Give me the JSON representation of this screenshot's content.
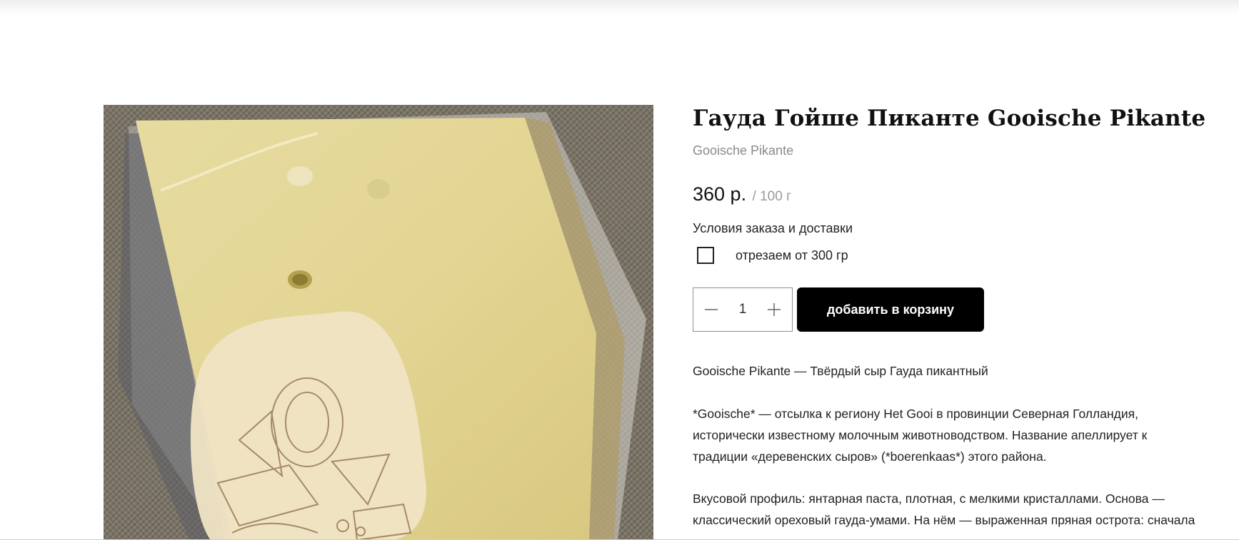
{
  "product": {
    "title": "Гауда Гойше Пиканте Gooische Pikante",
    "subtitle": "Gooische Pikante",
    "price": "360 р.",
    "unit": "/ 100 г",
    "delivery_link": "Условия заказа и доставки",
    "option_label": "отрезаем от 300 гр",
    "option_checked": false,
    "quantity": "1",
    "add_to_cart_label": "добавить в корзину",
    "image_icon": "cheese-photo"
  },
  "description": {
    "p1": "Gooische Pikante — Твёрдый сыр Гауда пикантный",
    "p2_l1": "*Gooische* — отсылка к региону Het Gooi в провинции Северная Голландия,",
    "p2_l2": "исторически известному молочным животноводством. Название апеллирует к",
    "p2_l3": "традиции «деревенских сыров» (*boerenkaas*) этого района.",
    "p3_l1": "Вкусовой профиль: янтарная паста, плотная, с мелкими кристаллами. Основа —",
    "p3_l2": "классический ореховый гауда-умами. На нём — выраженная пряная острота: сначала"
  },
  "colors": {
    "button_bg": "#000000",
    "button_text": "#ffffff",
    "muted_text": "#8a8a8a"
  }
}
